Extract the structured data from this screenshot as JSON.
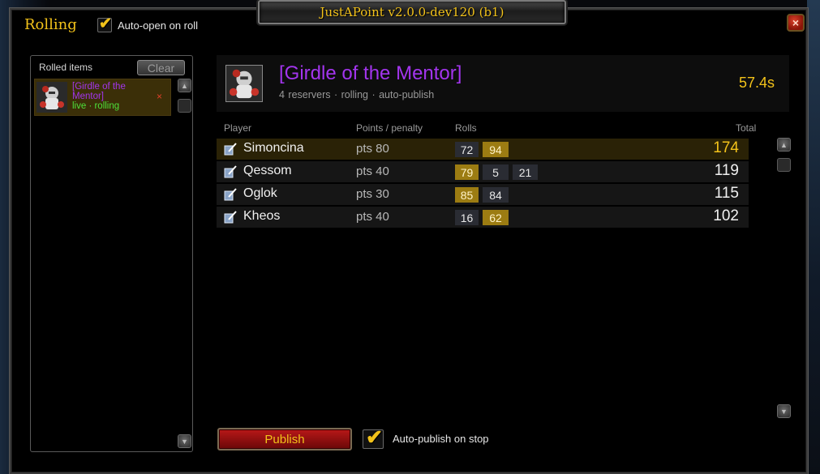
{
  "window": {
    "title": "JustAPoint  v2.0.0-dev120 (b1)",
    "close_label": "×"
  },
  "header": {
    "title": "Rolling",
    "auto_open_label": "Auto-open on roll",
    "auto_open_checked": true
  },
  "rolled_items": {
    "heading": "Rolled items",
    "clear_label": "Clear",
    "items": [
      {
        "name": "[Girdle of the Mentor]",
        "status": "live · rolling",
        "remove_label": "×",
        "icon": "mentor-portrait-icon"
      }
    ]
  },
  "item": {
    "name": "[Girdle of the Mentor]",
    "meta": "4 reservers  ·  rolling  ·  auto-publish",
    "timer": "57.4s",
    "quality_color": "#a335ee",
    "icon": "mentor-portrait-icon"
  },
  "table": {
    "columns": [
      "Player",
      "Points / penalty",
      "Rolls",
      "Total"
    ],
    "rows": [
      {
        "player": "Simoncina",
        "points": "pts 80",
        "rolls": [
          "72",
          "94"
        ],
        "best_roll": 1,
        "total": "174",
        "highlight": true,
        "icon": "quill-icon"
      },
      {
        "player": "Qessom",
        "points": "pts 40",
        "rolls": [
          "79",
          "5",
          "21"
        ],
        "best_roll": 0,
        "total": "119",
        "highlight": false,
        "icon": "quill-icon"
      },
      {
        "player": "Oglok",
        "points": "pts 30",
        "rolls": [
          "85",
          "84"
        ],
        "best_roll": 0,
        "total": "115",
        "highlight": false,
        "icon": "quill-icon"
      },
      {
        "player": "Kheos",
        "points": "pts 40",
        "rolls": [
          "16",
          "62"
        ],
        "best_roll": 1,
        "total": "102",
        "highlight": false,
        "icon": "quill-icon"
      }
    ]
  },
  "footer": {
    "publish_label": "Publish",
    "auto_publish_label": "Auto-publish on stop",
    "auto_publish_checked": true
  },
  "colors": {
    "gold": "#f2c21a",
    "epic": "#a335ee",
    "live": "#4ee03a",
    "highlight_row": "#2a2206",
    "best_roll": "#9c7c12"
  }
}
